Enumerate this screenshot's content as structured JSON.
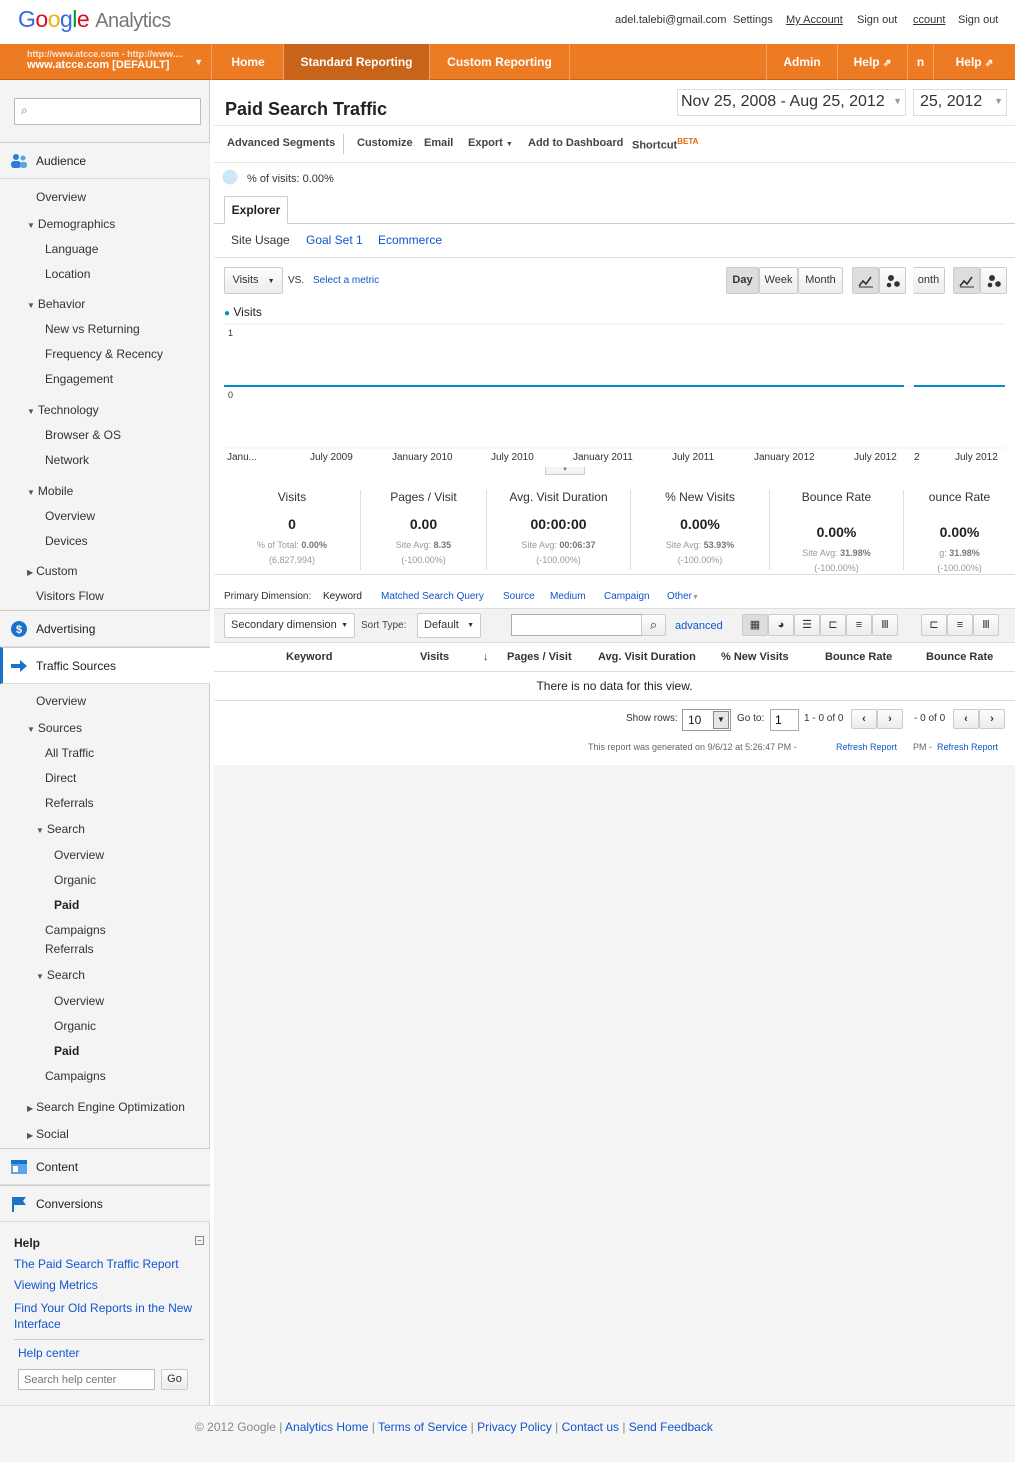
{
  "app": {
    "logo_google": "Google",
    "logo_product": "Analytics"
  },
  "toplinks": {
    "email": "adel.talebi@gmail.com",
    "settings": "Settings",
    "my_account": "My Account",
    "sign_out": "Sign out",
    "account_fragment": "ccount",
    "sign_out_2": "Sign out"
  },
  "profile": {
    "url": "http://www.atcce.com - http://www....",
    "name": "www.atcce.com [DEFAULT]"
  },
  "nav": {
    "home": "Home",
    "standard": "Standard Reporting",
    "custom": "Custom Reporting",
    "admin": "Admin",
    "help": "Help",
    "help_frag": "n",
    "help2": "Help"
  },
  "sidebar": {
    "audience": "Audience",
    "overview": "Overview",
    "demographics": "Demographics",
    "language": "Language",
    "location": "Location",
    "behavior": "Behavior",
    "new_vs_returning": "New vs Returning",
    "frequency": "Frequency & Recency",
    "engagement": "Engagement",
    "technology": "Technology",
    "browser_os": "Browser & OS",
    "network": "Network",
    "mobile": "Mobile",
    "mobile_overview": "Overview",
    "devices": "Devices",
    "custom": "Custom",
    "visitors_flow": "Visitors Flow",
    "advertising": "Advertising",
    "traffic_sources": "Traffic Sources",
    "ts_overview": "Overview",
    "sources": "Sources",
    "all_traffic": "All Traffic",
    "direct": "Direct",
    "referrals": "Referrals",
    "search": "Search",
    "search_overview": "Overview",
    "organic": "Organic",
    "paid": "Paid",
    "campaigns": "Campaigns",
    "referrals2": "Referrals",
    "search2": "Search",
    "search_overview2": "Overview",
    "organic2": "Organic",
    "paid2": "Paid",
    "campaigns2": "Campaigns",
    "seo": "Search Engine Optimization",
    "social": "Social",
    "content": "Content",
    "conversions": "Conversions"
  },
  "help": {
    "title": "Help",
    "link1": "The Paid Search Traffic Report",
    "link2": "Viewing Metrics",
    "link3": "Find Your Old Reports in the New Interface",
    "center": "Help center",
    "search_placeholder": "Search help center",
    "go": "Go"
  },
  "report": {
    "title": "Paid Search Traffic",
    "date_range": "Nov 25, 2008 - Aug 25, 2012",
    "date_frag": "25, 2012",
    "toolbar": {
      "segments": "Advanced Segments",
      "customize": "Customize",
      "email": "Email",
      "export": "Export",
      "dashboard": "Add to Dashboard",
      "shortcut": "Shortcut",
      "beta": "BETA"
    },
    "pct_visits": "% of visits: 0.00%",
    "tab_explorer": "Explorer",
    "subtabs": {
      "site_usage": "Site Usage",
      "goal_set": "Goal Set 1",
      "ecommerce": "Ecommerce"
    },
    "metric_select": "Visits",
    "vs": "VS.",
    "select_metric": "Select a metric",
    "granularity": {
      "day": "Day",
      "week": "Week",
      "month": "Month",
      "month_frag": "onth"
    },
    "legend": "Visits",
    "y_top": "1",
    "y_bottom": "0"
  },
  "chart_data": {
    "type": "line",
    "series": [
      {
        "name": "Visits",
        "values": [
          0,
          0
        ]
      }
    ],
    "x": [
      "Janu...",
      "July 2009",
      "January 2010",
      "July 2010",
      "January 2011",
      "July 2011",
      "January 2012",
      "July 2012"
    ],
    "x_frag": [
      "2",
      "July 2012"
    ],
    "ylim": [
      0,
      1
    ]
  },
  "metrics": [
    {
      "title": "Visits",
      "value": "0",
      "sub1": "% of Total:",
      "sub1b": "0.00%",
      "sub2": "(6,827,994)"
    },
    {
      "title": "Pages / Visit",
      "value": "0.00",
      "sub1": "Site Avg:",
      "sub1b": "8.35",
      "sub2": "(-100.00%)"
    },
    {
      "title": "Avg. Visit Duration",
      "value": "00:00:00",
      "sub1": "Site Avg:",
      "sub1b": "00:06:37",
      "sub2": "(-100.00%)"
    },
    {
      "title": "% New Visits",
      "value": "0.00%",
      "sub1": "Site Avg:",
      "sub1b": "53.93%",
      "sub2": "(-100.00%)"
    },
    {
      "title": "Bounce Rate",
      "value": "0.00%",
      "sub1": "Site Avg:",
      "sub1b": "31.98%",
      "sub2": "(-100.00%)"
    },
    {
      "title": "ounce Rate",
      "value": "0.00%",
      "sub1": "g:",
      "sub1b": "31.98%",
      "sub2": "(-100.00%)"
    }
  ],
  "dimension": {
    "label": "Primary Dimension:",
    "keyword": "Keyword",
    "matched": "Matched Search Query",
    "source": "Source",
    "medium": "Medium",
    "campaign": "Campaign",
    "other": "Other"
  },
  "table_controls": {
    "secondary": "Secondary dimension",
    "sort_type": "Sort Type:",
    "sort_default": "Default",
    "advanced": "advanced"
  },
  "table": {
    "headers": [
      "Keyword",
      "Visits",
      "Pages / Visit",
      "Avg. Visit Duration",
      "% New Visits",
      "Bounce Rate",
      "Bounce Rate"
    ],
    "empty": "There is no data for this view."
  },
  "pager": {
    "show_rows": "Show rows:",
    "rows": "10",
    "goto": "Go to:",
    "page": "1",
    "range": "1 - 0 of 0",
    "range_frag": "- 0 of 0"
  },
  "generated": {
    "text": "This report was generated on 9/6/12 at 5:26:47 PM -",
    "refresh": "Refresh Report",
    "frag": "PM -",
    "refresh2": "Refresh Report"
  },
  "footer": {
    "copyright": "© 2012 Google |",
    "home": "Analytics Home",
    "tos": "Terms of Service",
    "privacy": "Privacy Policy",
    "contact": "Contact us",
    "feedback": "Send Feedback"
  },
  "colors": {
    "orange": "#ed7b24",
    "link": "#1155cc",
    "series": "#058dc7"
  }
}
